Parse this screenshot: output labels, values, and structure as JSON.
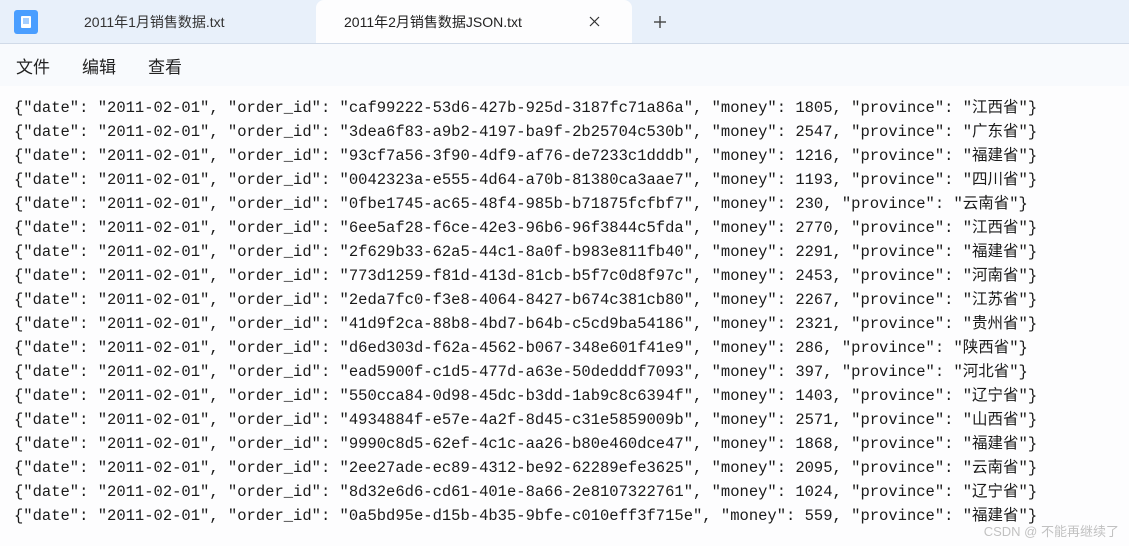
{
  "tabs": {
    "inactive": "2011年1月销售数据.txt",
    "active": "2011年2月销售数据JSON.txt"
  },
  "menu": {
    "file": "文件",
    "edit": "编辑",
    "view": "查看"
  },
  "records": [
    {
      "date": "2011-02-01",
      "order_id": "caf99222-53d6-427b-925d-3187fc71a86a",
      "money": 1805,
      "province": "江西省"
    },
    {
      "date": "2011-02-01",
      "order_id": "3dea6f83-a9b2-4197-ba9f-2b25704c530b",
      "money": 2547,
      "province": "广东省"
    },
    {
      "date": "2011-02-01",
      "order_id": "93cf7a56-3f90-4df9-af76-de7233c1dddb",
      "money": 1216,
      "province": "福建省"
    },
    {
      "date": "2011-02-01",
      "order_id": "0042323a-e555-4d64-a70b-81380ca3aae7",
      "money": 1193,
      "province": "四川省"
    },
    {
      "date": "2011-02-01",
      "order_id": "0fbe1745-ac65-48f4-985b-b71875fcfbf7",
      "money": 230,
      "province": "云南省"
    },
    {
      "date": "2011-02-01",
      "order_id": "6ee5af28-f6ce-42e3-96b6-96f3844c5fda",
      "money": 2770,
      "province": "江西省"
    },
    {
      "date": "2011-02-01",
      "order_id": "2f629b33-62a5-44c1-8a0f-b983e811fb40",
      "money": 2291,
      "province": "福建省"
    },
    {
      "date": "2011-02-01",
      "order_id": "773d1259-f81d-413d-81cb-b5f7c0d8f97c",
      "money": 2453,
      "province": "河南省"
    },
    {
      "date": "2011-02-01",
      "order_id": "2eda7fc0-f3e8-4064-8427-b674c381cb80",
      "money": 2267,
      "province": "江苏省"
    },
    {
      "date": "2011-02-01",
      "order_id": "41d9f2ca-88b8-4bd7-b64b-c5cd9ba54186",
      "money": 2321,
      "province": "贵州省"
    },
    {
      "date": "2011-02-01",
      "order_id": "d6ed303d-f62a-4562-b067-348e601f41e9",
      "money": 286,
      "province": "陕西省"
    },
    {
      "date": "2011-02-01",
      "order_id": "ead5900f-c1d5-477d-a63e-50dedddf7093",
      "money": 397,
      "province": "河北省"
    },
    {
      "date": "2011-02-01",
      "order_id": "550cca84-0d98-45dc-b3dd-1ab9c8c6394f",
      "money": 1403,
      "province": "辽宁省"
    },
    {
      "date": "2011-02-01",
      "order_id": "4934884f-e57e-4a2f-8d45-c31e5859009b",
      "money": 2571,
      "province": "山西省"
    },
    {
      "date": "2011-02-01",
      "order_id": "9990c8d5-62ef-4c1c-aa26-b80e460dce47",
      "money": 1868,
      "province": "福建省"
    },
    {
      "date": "2011-02-01",
      "order_id": "2ee27ade-ec89-4312-be92-62289efe3625",
      "money": 2095,
      "province": "云南省"
    },
    {
      "date": "2011-02-01",
      "order_id": "8d32e6d6-cd61-401e-8a66-2e8107322761",
      "money": 1024,
      "province": "辽宁省"
    },
    {
      "date": "2011-02-01",
      "order_id": "0a5bd95e-d15b-4b35-9bfe-c010eff3f715e",
      "money": 559,
      "province": "福建省"
    }
  ],
  "watermark": "CSDN @ 不能再继续了"
}
